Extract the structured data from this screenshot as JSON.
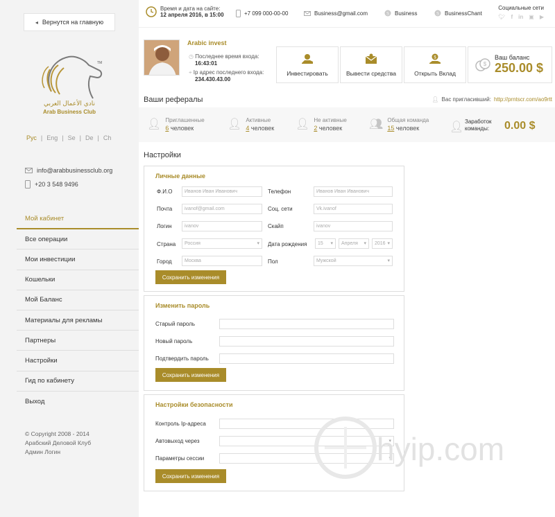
{
  "sidebar": {
    "back_label": "Вернутся на главную",
    "logo_arabic": "نادي الأعمال العربي",
    "logo_text": "Arab Business Club",
    "logo_tm": "TM",
    "languages": [
      "Рус",
      "Eng",
      "Se",
      "De",
      "Ch"
    ],
    "active_language": "Рус",
    "email": "info@arabbusinessclub.org",
    "phone": "+20 3 548 9496",
    "nav": [
      "Мой кабинет",
      "Все операции",
      "Мои инвестиции",
      "Кошельки",
      "Мой Баланс",
      "Материалы для рекламы",
      "Партнеры",
      "Настройки",
      "Гид по кабинету",
      "Выход"
    ],
    "copyright": [
      "© Copyright 2008 - 2014",
      "Арабский Деловой Клуб",
      "Админ Логин"
    ]
  },
  "topbar": {
    "datetime_label": "Время и дата на сайте:",
    "datetime_value": "12 апреля 2016, в 15:00",
    "phone": "+7 099 000-00-00",
    "email": "Business@gmail.com",
    "skype1": "Business",
    "skype2": "BusinessChant",
    "social_label": "Социальные сети",
    "social_icons": [
      "twitter-icon",
      "facebook-icon",
      "linkedin-icon",
      "instagram-icon",
      "youtube-icon"
    ]
  },
  "profile": {
    "name": "Arabic invest",
    "last_login_label": "Последнее время входа:",
    "last_login_value": "16:43:01",
    "ip_label": "Ip адрес последнего входа:",
    "ip_value": "234.430.43.00"
  },
  "actions": [
    "Инвестировать",
    "Вывести средства",
    "Открыть Вклад"
  ],
  "balance": {
    "label": "Ваш баланс",
    "value": "250.00 $"
  },
  "referrals": {
    "title": "Ваши рефералы",
    "inviter_label": "Вас пригласивший:",
    "inviter_link": "http://prntscr.com/ao9rtt",
    "items": [
      {
        "label": "Приглашенные",
        "count": "6",
        "unit": "человек"
      },
      {
        "label": "Активные",
        "count": "4",
        "unit": "человек"
      },
      {
        "label": "Не активные",
        "count": "2",
        "unit": "человек"
      },
      {
        "label": "Общая команда",
        "count": "15",
        "unit": "человек"
      }
    ],
    "earnings_label_1": "Заработок",
    "earnings_label_2": "команды:",
    "earnings_value": "0.00 $"
  },
  "settings": {
    "title": "Настройки",
    "personal": {
      "title": "Личные данные",
      "fio_label": "Ф.И.О",
      "fio_value": "Иванов Иван Иванович",
      "phone_label": "Телефон",
      "phone_value": "Иванов Иван Иванович",
      "email_label": "Почта",
      "email_value": "ivanof@gmail.com",
      "social_label": "Соц. сети",
      "social_value": "Vk.ivanof",
      "login_label": "Логин",
      "login_value": "ivanov",
      "skype_label": "Скайп",
      "skype_value": "ivanov",
      "country_label": "Страна",
      "country_value": "Россия",
      "birth_label": "Дата рождения",
      "birth_day": "15",
      "birth_month": "Апреля",
      "birth_year": "2016",
      "city_label": "Город",
      "city_value": "Москва",
      "gender_label": "Пол",
      "gender_value": "Мужской",
      "save_label": "Сохранить изменения"
    },
    "password": {
      "title": "Изменить пароль",
      "old_label": "Старый пароль",
      "new_label": "Новый пароль",
      "confirm_label": "Подтвердить пароль",
      "save_label": "Сохранить изменения"
    },
    "security": {
      "title": "Настройки безопасности",
      "ip_label": "Контроль Ip-адреса",
      "autologout_label": "Автовыход через",
      "session_label": "Параметры сессии",
      "save_label": "Сохранить изменения"
    }
  },
  "watermark": "hyip.com",
  "colors": {
    "accent": "#a98c2a",
    "sidebar_bg": "#f3f3f3"
  }
}
